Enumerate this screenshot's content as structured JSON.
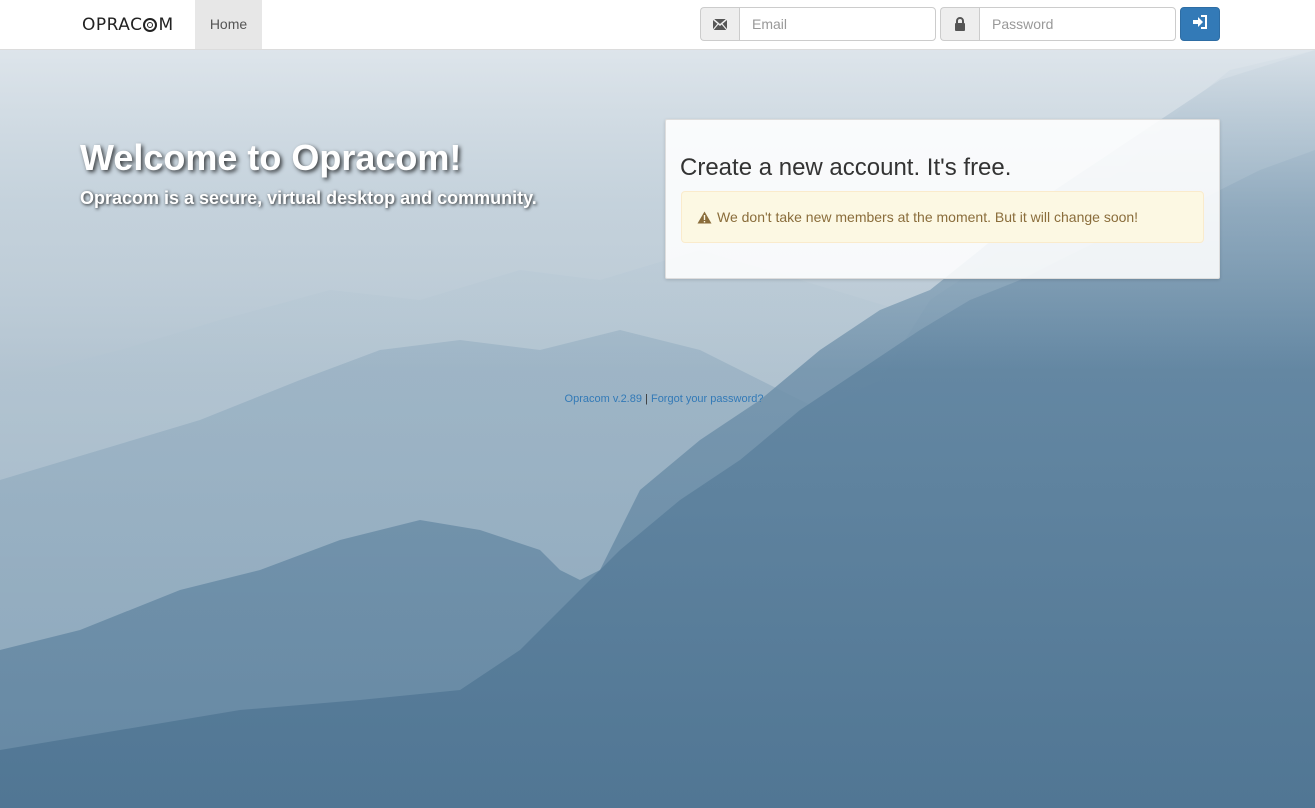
{
  "navbar": {
    "brand": {
      "prefix": "OPRAC",
      "suffix": "M"
    },
    "home_label": "Home",
    "email_placeholder": "Email",
    "password_placeholder": "Password",
    "login_icon": "sign-in-icon",
    "email_icon": "envelope-icon",
    "password_icon": "lock-icon"
  },
  "hero": {
    "title": "Welcome to Opracom!",
    "subtitle": "Opracom is a secure, virtual desktop and community."
  },
  "signup": {
    "heading": "Create a new account. It's free.",
    "alert_icon": "warning-icon",
    "alert_text": "We don't take new members at the moment. But it will change soon!"
  },
  "footer": {
    "version_link": "Opracom v.2.89",
    "separator": "|",
    "forgot_link": "Forgot your password?"
  },
  "colors": {
    "primary": "#337ab7",
    "alert_bg": "#fcf8e3",
    "alert_text": "#8a6d3b",
    "nav_active_bg": "#e7e7e7"
  }
}
